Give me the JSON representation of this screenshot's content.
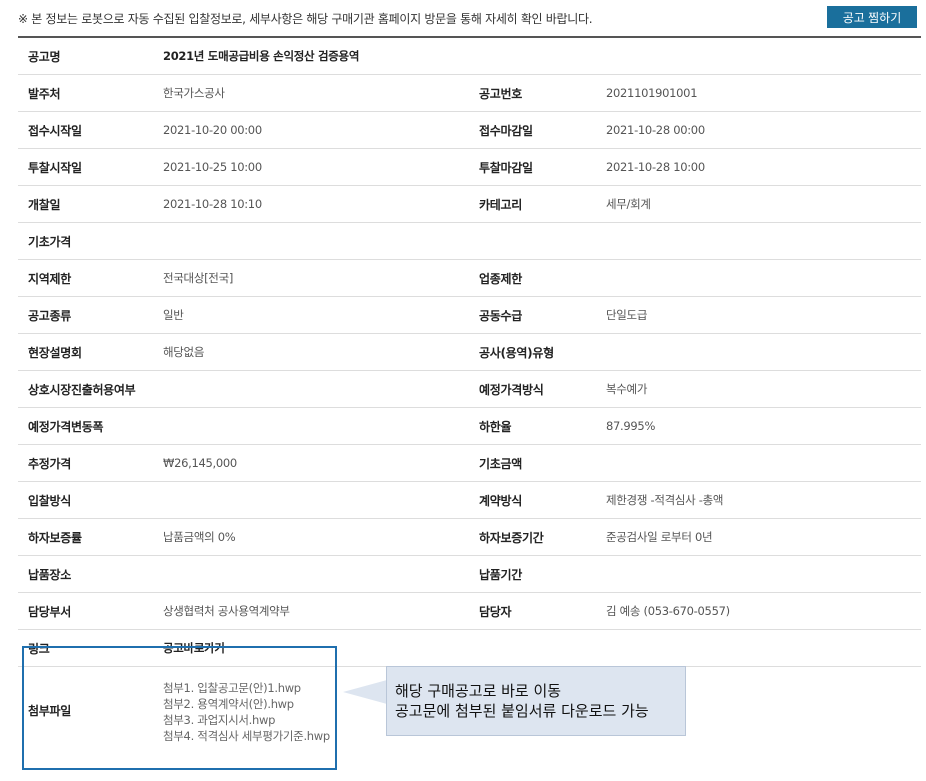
{
  "notice": "※ 본 정보는 로봇으로 자동 수집된 입찰정보로, 세부사항은 해당 구매기관 홈페이지 방문을 통해 자세히 확인 바랍니다.",
  "save_button": "공고 찜하기",
  "rows": [
    {
      "l1": "공고명",
      "v1": "2021년 도매공급비용 손익정산 검증용역"
    },
    {
      "l1": "발주처",
      "v1": "한국가스공사",
      "l2": "공고번호",
      "v2": "2021101901001"
    },
    {
      "l1": "접수시작일",
      "v1": "2021-10-20 00:00",
      "l2": "접수마감일",
      "v2": "2021-10-28 00:00"
    },
    {
      "l1": "투찰시작일",
      "v1": "2021-10-25 10:00",
      "l2": "투찰마감일",
      "v2": "2021-10-28 10:00"
    },
    {
      "l1": "개찰일",
      "v1": "2021-10-28 10:10",
      "l2": "카테고리",
      "v2": "세무/회계"
    },
    {
      "l1": "기초가격",
      "v1": ""
    },
    {
      "l1": "지역제한",
      "v1": "전국대상[전국]",
      "l2": "업종제한",
      "v2": ""
    },
    {
      "l1": "공고종류",
      "v1": "일반",
      "l2": "공동수급",
      "v2": "단일도급"
    },
    {
      "l1": "현장설명회",
      "v1": "해당없음",
      "l2": "공사(용역)유형",
      "v2": ""
    },
    {
      "l1": "상호시장진출허용여부",
      "v1": "",
      "l2": "예정가격방식",
      "v2": "복수예가"
    },
    {
      "l1": "예정가격변동폭",
      "v1": "",
      "l2": "하한율",
      "v2": "87.995%"
    },
    {
      "l1": "추정가격",
      "v1": "₩26,145,000",
      "l2": "기초금액",
      "v2": ""
    },
    {
      "l1": "입찰방식",
      "v1": "",
      "l2": "계약방식",
      "v2": "제한경쟁 -적격심사 -총액"
    },
    {
      "l1": "하자보증률",
      "v1": "납품금액의 0%",
      "l2": "하자보증기간",
      "v2": "준공검사일 로부터 0년"
    },
    {
      "l1": "납품장소",
      "v1": "",
      "l2": "납품기간",
      "v2": ""
    },
    {
      "l1": "담당부서",
      "v1": "상생협력처 공사용역계약부",
      "l2": "담당자",
      "v2": "김 예송 (053-670-0557)"
    }
  ],
  "link": {
    "label": "링크",
    "value": "공고바로가기"
  },
  "attachments": {
    "label": "첨부파일",
    "files": [
      "첨부1. 입찰공고문(안)1.hwp",
      "첨부2. 용역계약서(안).hwp",
      "첨부3. 과업지시서.hwp",
      "첨부4. 적격심사 세부평가기준.hwp"
    ]
  },
  "callout": {
    "line1": "해당 구매공고로 바로 이동",
    "line2": "공고문에 첨부된 붙임서류 다운로드 가능"
  }
}
